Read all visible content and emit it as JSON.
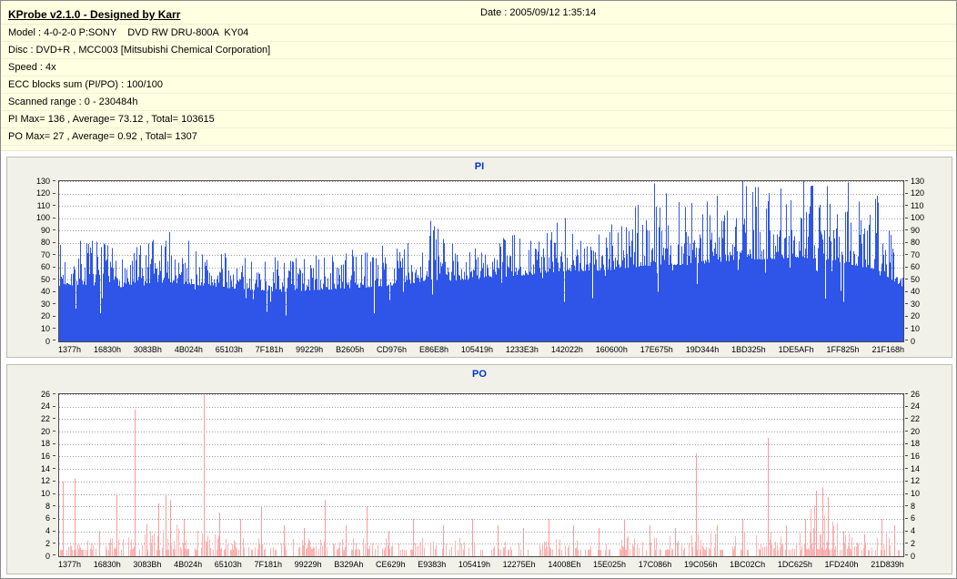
{
  "window": {
    "title": "KProbe v2.1.0 - Designed by Karr",
    "date_label": "Date : 2005/09/12 1:35:14"
  },
  "info": {
    "lines": [
      "Model : 4-0-2-0 P:SONY    DVD RW DRU-800A  KY04",
      "Disc : DVD+R , MCC003 [Mitsubishi Chemical Corporation]",
      "Speed : 4x",
      "ECC blocks sum (PI/PO) : 100/100",
      "Scanned range : 0 - 230484h",
      "PI Max= 136 , Average= 73.12 , Total= 103615",
      "PO Max= 27 , Average= 0.92 , Total= 1307"
    ]
  },
  "chart_data": [
    {
      "type": "bar",
      "kind": "dense",
      "title": "PI",
      "seed": 7,
      "color": "#2e55e8",
      "ylim": [
        0,
        130
      ],
      "ytick_step": 10,
      "grid": "horizontal-dashed",
      "legend": "none",
      "x_labels": [
        "1377h",
        "16830h",
        "3083Bh",
        "4B024h",
        "65103h",
        "7F181h",
        "99229h",
        "B2605h",
        "CD976h",
        "E86E8h",
        "105419h",
        "1233E3h",
        "142022h",
        "160600h",
        "17E675h",
        "19D344h",
        "1BD325h",
        "1DE5AFh",
        "1FF825h",
        "21F168h"
      ],
      "stats": {
        "max": 136,
        "average": 73.12,
        "total": 103615
      },
      "envelope": [
        {
          "x": 0.0,
          "lo": 45,
          "hi": 80
        },
        {
          "x": 0.03,
          "lo": 46,
          "hi": 88
        },
        {
          "x": 0.07,
          "lo": 44,
          "hi": 74
        },
        {
          "x": 0.1,
          "lo": 45,
          "hi": 80
        },
        {
          "x": 0.13,
          "lo": 48,
          "hi": 92
        },
        {
          "x": 0.17,
          "lo": 45,
          "hi": 76
        },
        {
          "x": 0.22,
          "lo": 42,
          "hi": 68
        },
        {
          "x": 0.27,
          "lo": 40,
          "hi": 70
        },
        {
          "x": 0.32,
          "lo": 42,
          "hi": 72
        },
        {
          "x": 0.37,
          "lo": 44,
          "hi": 76
        },
        {
          "x": 0.42,
          "lo": 47,
          "hi": 86
        },
        {
          "x": 0.44,
          "lo": 50,
          "hi": 98
        },
        {
          "x": 0.47,
          "lo": 49,
          "hi": 78
        },
        {
          "x": 0.52,
          "lo": 52,
          "hi": 84
        },
        {
          "x": 0.56,
          "lo": 54,
          "hi": 92
        },
        {
          "x": 0.6,
          "lo": 57,
          "hi": 100
        },
        {
          "x": 0.64,
          "lo": 57,
          "hi": 92
        },
        {
          "x": 0.68,
          "lo": 60,
          "hi": 108
        },
        {
          "x": 0.71,
          "lo": 62,
          "hi": 126
        },
        {
          "x": 0.74,
          "lo": 62,
          "hi": 112
        },
        {
          "x": 0.78,
          "lo": 64,
          "hi": 118
        },
        {
          "x": 0.81,
          "lo": 66,
          "hi": 130
        },
        {
          "x": 0.85,
          "lo": 67,
          "hi": 120
        },
        {
          "x": 0.88,
          "lo": 68,
          "hi": 131
        },
        {
          "x": 0.91,
          "lo": 66,
          "hi": 122
        },
        {
          "x": 0.94,
          "lo": 62,
          "hi": 112
        },
        {
          "x": 0.97,
          "lo": 58,
          "hi": 118
        },
        {
          "x": 1.0,
          "lo": 44,
          "hi": 96
        }
      ],
      "spikes": [
        {
          "x": 0.44,
          "v": 98
        },
        {
          "x": 0.6,
          "v": 100
        },
        {
          "x": 0.655,
          "v": 95
        },
        {
          "x": 0.705,
          "v": 128
        },
        {
          "x": 0.72,
          "v": 120
        },
        {
          "x": 0.78,
          "v": 118
        },
        {
          "x": 0.81,
          "v": 130
        },
        {
          "x": 0.855,
          "v": 124
        },
        {
          "x": 0.882,
          "v": 131
        },
        {
          "x": 0.91,
          "v": 126
        },
        {
          "x": 0.935,
          "v": 129
        },
        {
          "x": 0.97,
          "v": 118
        }
      ]
    },
    {
      "type": "bar",
      "kind": "sparse",
      "title": "PO",
      "seed": 13,
      "color": "#ffb2b2",
      "spike_color": "#ff9a9a",
      "ylim": [
        0,
        26
      ],
      "ytick_step": 2,
      "grid": "horizontal-dashed",
      "legend": "none",
      "x_labels": [
        "1377h",
        "16830h",
        "3083Bh",
        "4B024h",
        "65103h",
        "7F181h",
        "99229h",
        "B329Ah",
        "CE629h",
        "E9383h",
        "105419h",
        "12275Eh",
        "14008Eh",
        "15E025h",
        "17C086h",
        "19C056h",
        "1BC02Ch",
        "1DC625h",
        "1FD240h",
        "21D839h"
      ],
      "stats": {
        "max": 27,
        "average": 0.92,
        "total": 1307
      },
      "envelope": [
        {
          "x": 0.0,
          "d": 0.5,
          "hi": 3
        },
        {
          "x": 0.05,
          "d": 0.45,
          "hi": 3
        },
        {
          "x": 0.09,
          "d": 0.5,
          "hi": 4
        },
        {
          "x": 0.12,
          "d": 0.75,
          "hi": 7
        },
        {
          "x": 0.16,
          "d": 0.6,
          "hi": 5
        },
        {
          "x": 0.2,
          "d": 0.45,
          "hi": 3
        },
        {
          "x": 0.3,
          "d": 0.4,
          "hi": 3
        },
        {
          "x": 0.4,
          "d": 0.42,
          "hi": 3
        },
        {
          "x": 0.5,
          "d": 0.42,
          "hi": 3.5
        },
        {
          "x": 0.6,
          "d": 0.4,
          "hi": 3
        },
        {
          "x": 0.7,
          "d": 0.42,
          "hi": 3.5
        },
        {
          "x": 0.8,
          "d": 0.45,
          "hi": 4
        },
        {
          "x": 0.875,
          "d": 0.5,
          "hi": 4
        },
        {
          "x": 0.895,
          "d": 0.95,
          "hi": 9
        },
        {
          "x": 0.915,
          "d": 0.9,
          "hi": 8
        },
        {
          "x": 0.93,
          "d": 0.5,
          "hi": 4
        },
        {
          "x": 1.0,
          "d": 0.45,
          "hi": 4
        }
      ],
      "spikes": [
        {
          "x": 0.004,
          "v": 12
        },
        {
          "x": 0.018,
          "v": 12.5
        },
        {
          "x": 0.048,
          "v": 4
        },
        {
          "x": 0.068,
          "v": 10
        },
        {
          "x": 0.09,
          "v": 23.5
        },
        {
          "x": 0.104,
          "v": 5
        },
        {
          "x": 0.118,
          "v": 8.5
        },
        {
          "x": 0.126,
          "v": 10
        },
        {
          "x": 0.132,
          "v": 9
        },
        {
          "x": 0.148,
          "v": 6
        },
        {
          "x": 0.172,
          "v": 26.5
        },
        {
          "x": 0.19,
          "v": 7
        },
        {
          "x": 0.215,
          "v": 6
        },
        {
          "x": 0.24,
          "v": 8
        },
        {
          "x": 0.266,
          "v": 5
        },
        {
          "x": 0.29,
          "v": 4.5
        },
        {
          "x": 0.315,
          "v": 9
        },
        {
          "x": 0.34,
          "v": 5
        },
        {
          "x": 0.365,
          "v": 8
        },
        {
          "x": 0.39,
          "v": 4
        },
        {
          "x": 0.42,
          "v": 6
        },
        {
          "x": 0.455,
          "v": 5
        },
        {
          "x": 0.49,
          "v": 6
        },
        {
          "x": 0.52,
          "v": 5
        },
        {
          "x": 0.55,
          "v": 4.5
        },
        {
          "x": 0.58,
          "v": 6
        },
        {
          "x": 0.61,
          "v": 5
        },
        {
          "x": 0.64,
          "v": 4.5
        },
        {
          "x": 0.67,
          "v": 6
        },
        {
          "x": 0.7,
          "v": 5
        },
        {
          "x": 0.73,
          "v": 4.5
        },
        {
          "x": 0.755,
          "v": 16.5
        },
        {
          "x": 0.78,
          "v": 5
        },
        {
          "x": 0.81,
          "v": 6
        },
        {
          "x": 0.84,
          "v": 19
        },
        {
          "x": 0.862,
          "v": 5
        },
        {
          "x": 0.885,
          "v": 6
        },
        {
          "x": 0.898,
          "v": 10.5
        },
        {
          "x": 0.905,
          "v": 11
        },
        {
          "x": 0.912,
          "v": 9.5
        },
        {
          "x": 0.93,
          "v": 4
        },
        {
          "x": 0.955,
          "v": 3.5
        },
        {
          "x": 0.975,
          "v": 6
        },
        {
          "x": 0.99,
          "v": 5
        }
      ]
    }
  ]
}
